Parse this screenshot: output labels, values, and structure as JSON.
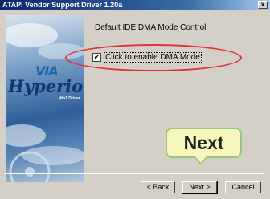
{
  "window": {
    "title": "ATAPI Vendor Support Driver 1.20a",
    "close_glyph": "x"
  },
  "sidepanel": {
    "logo_mark": "VIA",
    "logo_text": "Hyperion",
    "logo_sub": "4in1 Driver"
  },
  "content": {
    "description": "Default IDE DMA Mode Control",
    "checkbox": {
      "label": "Click to enable DMA Mode",
      "checked": true
    }
  },
  "annotation": {
    "callout_text": "Next",
    "highlight_color": "#e2313a",
    "callout_bg": "#f6f6bd"
  },
  "buttons": {
    "back": "< Back",
    "next": "Next >",
    "cancel": "Cancel"
  }
}
